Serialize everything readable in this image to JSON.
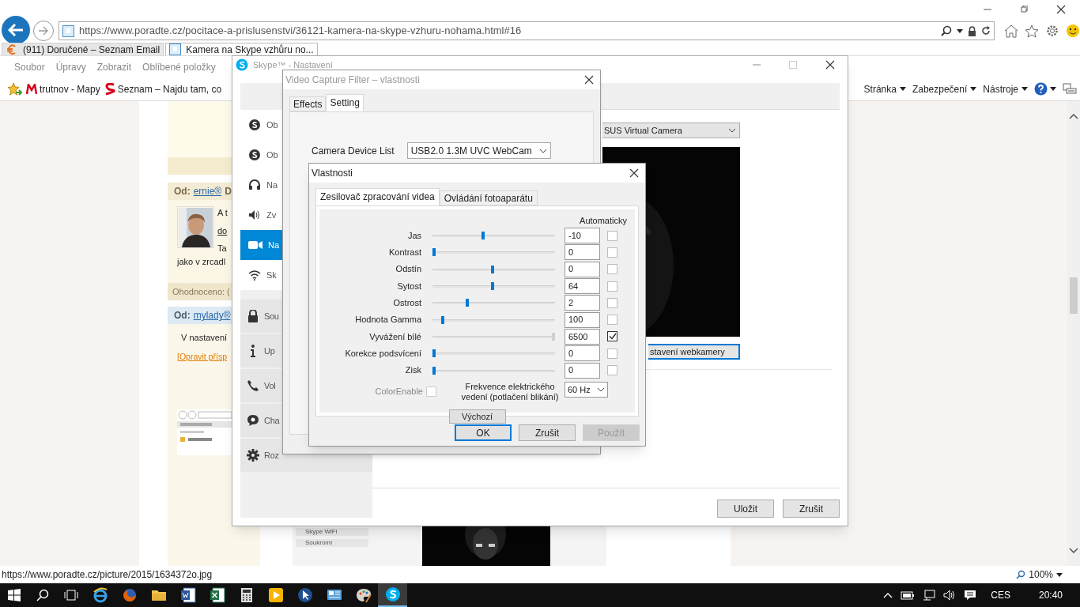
{
  "browser": {
    "url": "https://www.poradte.cz/pocitace-a-prislusenstvi/36121-kamera-na-skype-vzhuru-nohama.html#16",
    "tabs": [
      {
        "label": "(911) Doručené – Seznam Email",
        "selected": false,
        "kind": "seznam"
      },
      {
        "label": "Kamera na Skype vzhůru no...",
        "selected": true,
        "kind": "page"
      }
    ],
    "menu": [
      "Soubor",
      "Úpravy",
      "Zobrazit",
      "Oblíbené položky"
    ],
    "favorites": [
      {
        "label": "trutnov - Mapy",
        "kind": "mapy"
      },
      {
        "label": "Seznam – Najdu tam, co",
        "kind": "seznam"
      }
    ],
    "command_bar": [
      "Stránka",
      "Zabezpečení",
      "Nástroje"
    ],
    "status_url": "https://www.poradte.cz/picture/2015/1634372o.jpg",
    "zoom": "100%"
  },
  "page": {
    "post1": {
      "from": "Od:",
      "author": "ernie®",
      "extra": "D",
      "lines": [
        "A t",
        "do",
        "Ta"
      ],
      "wide_line": "jako v zrcadl",
      "rating": "Ohodnoceno: ("
    },
    "post2": {
      "from": "Od:",
      "author": "mylady®",
      "text": "V nastavení",
      "link": "[Opravit přísp"
    },
    "lower_screenshot": {
      "items": [
        "Skype WiFi",
        "Soukromí"
      ]
    }
  },
  "skype": {
    "title": "Skype™ - Nastavení",
    "nav": [
      {
        "label": "Ob",
        "kind": "skype",
        "selected": false
      },
      {
        "label": "Ob",
        "kind": "skype",
        "selected": false
      },
      {
        "label": "Na",
        "kind": "headset",
        "selected": false
      },
      {
        "label": "Zv",
        "kind": "speaker",
        "selected": false
      },
      {
        "label": "Na",
        "kind": "camera",
        "selected": true
      },
      {
        "label": "Sk",
        "kind": "wifi",
        "selected": false
      }
    ],
    "nav_tiles": [
      {
        "label": "Sou",
        "kind": "lock"
      },
      {
        "label": "Up",
        "kind": "info"
      },
      {
        "label": "Vol",
        "kind": "phone"
      },
      {
        "label": "Cha",
        "kind": "chat"
      },
      {
        "label": "Roz",
        "kind": "gear"
      }
    ],
    "camera_select": "SUS Virtual Camera",
    "settings_button": "stavení webkamery",
    "buttons": [
      "Uložit",
      "Zrušit"
    ]
  },
  "capture_filter": {
    "title": "Video Capture Filter – vlastnosti",
    "tabs": [
      {
        "label": "Effects",
        "selected": false
      },
      {
        "label": "Setting",
        "selected": true
      }
    ],
    "device_label": "Camera Device List",
    "device": "USB2.0 1.3M UVC WebCam"
  },
  "properties": {
    "title": "Vlastnosti",
    "tabs": [
      {
        "label": "Zesilovač zpracování videa",
        "selected": true
      },
      {
        "label": "Ovládání fotoaparátu",
        "selected": false
      }
    ],
    "auto_header": "Automaticky",
    "rows": [
      {
        "label": "Jas",
        "level": 0.41,
        "value": "-10",
        "auto": false,
        "disabled": false
      },
      {
        "label": "Kontrast",
        "level": 0,
        "value": "0",
        "auto": false,
        "disabled": false
      },
      {
        "label": "Odstín",
        "level": 0.49,
        "value": "0",
        "auto": false,
        "disabled": false
      },
      {
        "label": "Sytost",
        "level": 0.49,
        "value": "64",
        "auto": false,
        "disabled": false
      },
      {
        "label": "Ostrost",
        "level": 0.28,
        "value": "2",
        "auto": false,
        "disabled": false
      },
      {
        "label": "Hodnota Gamma",
        "level": 0.07,
        "value": "100",
        "auto": false,
        "disabled": false
      },
      {
        "label": "Vyvážení bílé",
        "level": 1,
        "value": "6500",
        "auto": true,
        "disabled": true
      },
      {
        "label": "Korekce podsvícení",
        "level": 0,
        "value": "0",
        "auto": false,
        "disabled": false
      },
      {
        "label": "Zisk",
        "level": 0,
        "value": "0",
        "auto": false,
        "disabled": false
      }
    ],
    "color_enable": {
      "label": "ColorEnable",
      "checked": false,
      "disabled": true
    },
    "frequency_label": "Frekvence elektrického vedení (potlačení blikání)",
    "frequency": "60 Hz",
    "default_button": "Výchozí",
    "buttons": [
      {
        "label": "OK",
        "default": true,
        "disabled": false
      },
      {
        "label": "Zrušit",
        "default": false,
        "disabled": false
      },
      {
        "label": "Použít",
        "default": false,
        "disabled": true
      }
    ]
  },
  "taskbar": {
    "apps": [
      {
        "kind": "ie",
        "active": false
      },
      {
        "kind": "firefox",
        "active": false
      },
      {
        "kind": "folder",
        "active": false
      },
      {
        "kind": "word",
        "active": false
      },
      {
        "kind": "excel",
        "active": false
      },
      {
        "kind": "calculator",
        "active": false
      },
      {
        "kind": "media",
        "active": false
      },
      {
        "kind": "cursor",
        "active": false
      },
      {
        "kind": "network",
        "active": false
      },
      {
        "kind": "paint",
        "active": false
      },
      {
        "kind": "skype",
        "active": true
      }
    ],
    "language": "CES",
    "time": "20:40"
  }
}
